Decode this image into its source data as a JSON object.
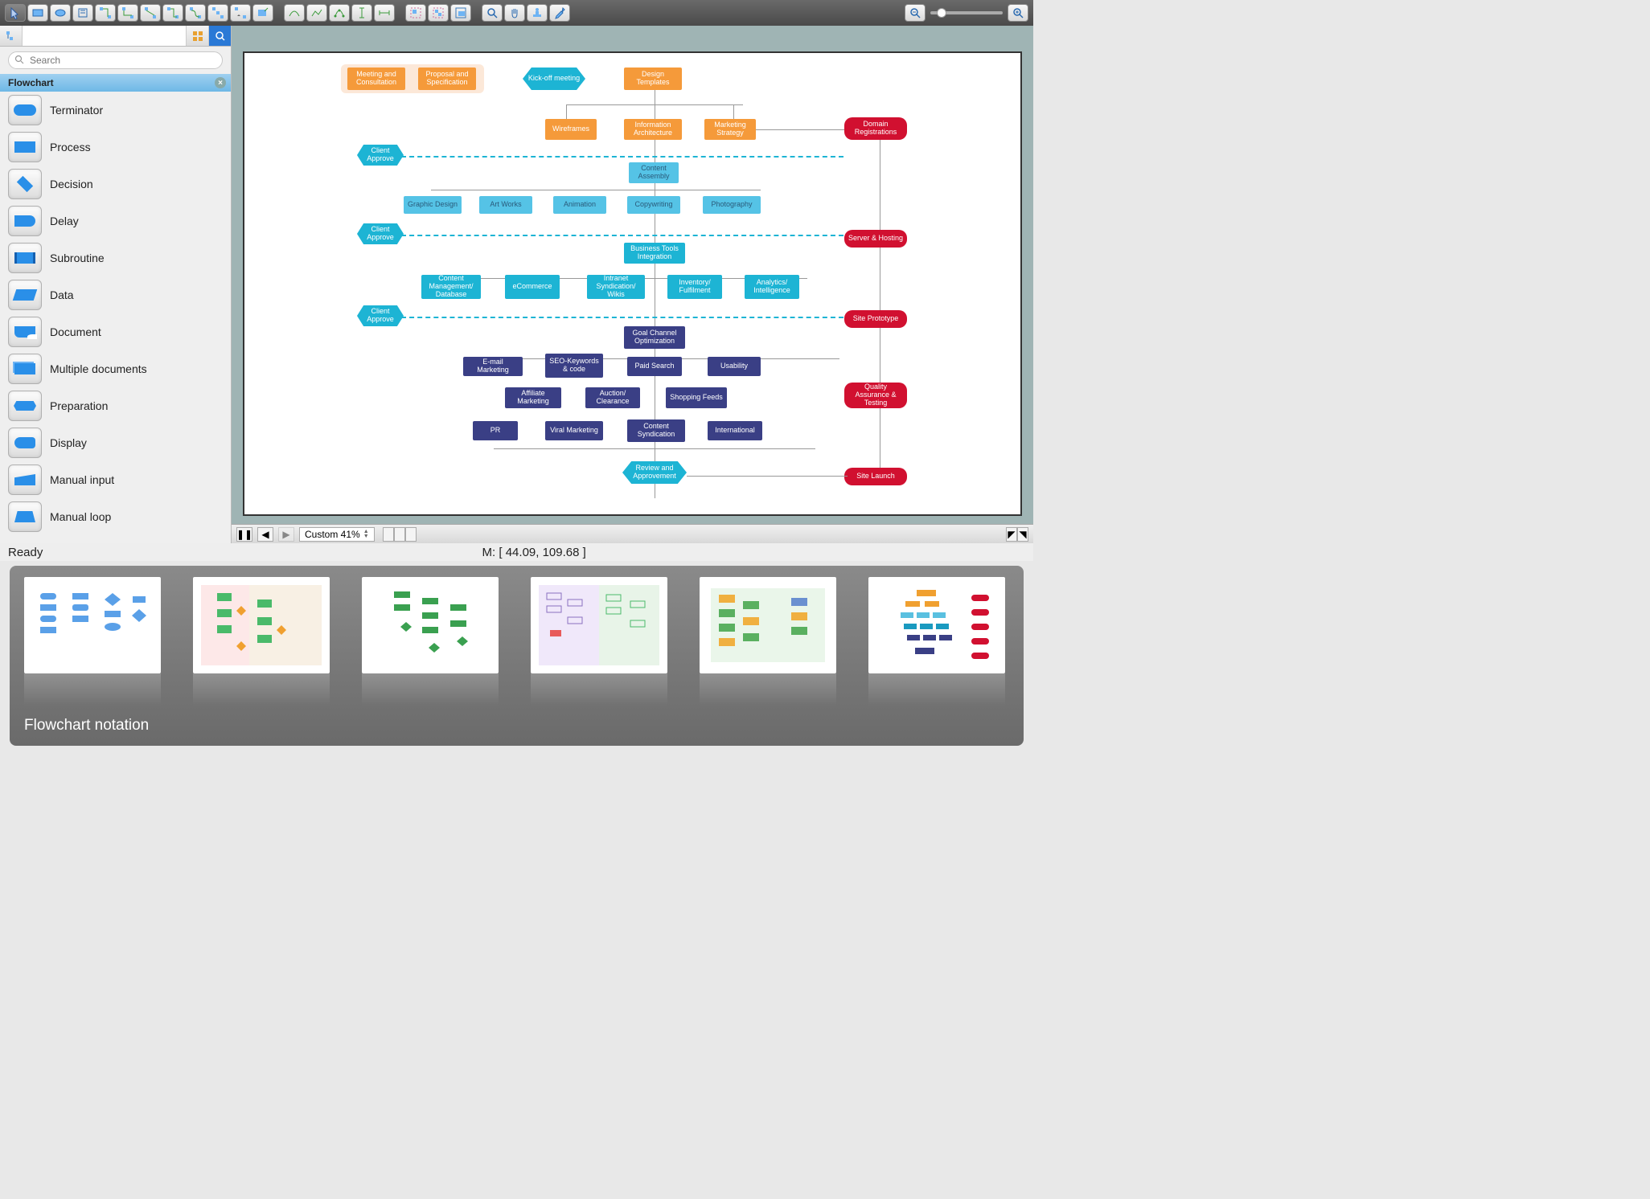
{
  "toolbar": {
    "groups": [
      [
        "pointer",
        "rectangle",
        "ellipse",
        "text",
        "connector-1",
        "connector-2",
        "connector-3",
        "connector-4",
        "connector-5",
        "connector-6",
        "connector-menu",
        "quick-shape"
      ],
      [
        "curve",
        "polyline",
        "spline",
        "bracket-v",
        "bracket-h"
      ],
      [
        "group",
        "ungroup",
        "align"
      ],
      [
        "zoom-tool",
        "pan-tool",
        "stamp-tool",
        "eyedropper"
      ]
    ]
  },
  "sidebar": {
    "search_placeholder": "Search",
    "section": "Flowchart",
    "items": [
      {
        "key": "terminator",
        "label": "Terminator"
      },
      {
        "key": "process",
        "label": "Process"
      },
      {
        "key": "decision",
        "label": "Decision"
      },
      {
        "key": "delay",
        "label": "Delay"
      },
      {
        "key": "subroutine",
        "label": "Subroutine"
      },
      {
        "key": "data",
        "label": "Data"
      },
      {
        "key": "document",
        "label": "Document"
      },
      {
        "key": "mdoc",
        "label": "Multiple documents"
      },
      {
        "key": "prep",
        "label": "Preparation"
      },
      {
        "key": "display",
        "label": "Display"
      },
      {
        "key": "minput",
        "label": "Manual input"
      },
      {
        "key": "mloop",
        "label": "Manual loop"
      }
    ]
  },
  "canvas": {
    "zoom_label": "Custom 41%",
    "nodes": {
      "meeting": "Meeting and Consultation",
      "proposal": "Proposal and Specification",
      "kickoff": "Kick-off meeting",
      "design": "Design Templates",
      "wireframes": "Wireframes",
      "ia": "Information Architecture",
      "mkt_strategy": "Marketing Strategy",
      "domain": "Domain Registrations",
      "approve1": "Client Approve",
      "content_assembly": "Content Assembly",
      "graphic": "Graphic Design",
      "artworks": "Art Works",
      "animation": "Animation",
      "copywriting": "Copywriting",
      "photography": "Photography",
      "approve2": "Client Approve",
      "server": "Server & Hosting",
      "bti": "Business Tools Integration",
      "cms": "Content Management/ Database",
      "ecommerce": "eCommerce",
      "intranet": "Intranet Syndication/ Wikis",
      "inventory": "Inventory/ Fulfilment",
      "analytics": "Analytics/ Intelligence",
      "approve3": "Client Approve",
      "prototype": "Site Prototype",
      "goal": "Goal Channel Optimization",
      "email": "E-mail Marketing",
      "seo": "SEO-Keywords & code",
      "paid": "Paid Search",
      "usability": "Usability",
      "affiliate": "Affiliate Marketing",
      "auction": "Auction/ Clearance",
      "shopping": "Shopping Feeds",
      "qa": "Quality Assurance & Testing",
      "pr": "PR",
      "viral": "Viral Marketing",
      "syndication": "Content Syndication",
      "intl": "International",
      "review": "Review and Approvement",
      "launch": "Site Launch"
    }
  },
  "status": {
    "ready": "Ready",
    "coords": "M: [ 44.09, 109.68 ]"
  },
  "gallery": {
    "title": "Flowchart notation"
  }
}
